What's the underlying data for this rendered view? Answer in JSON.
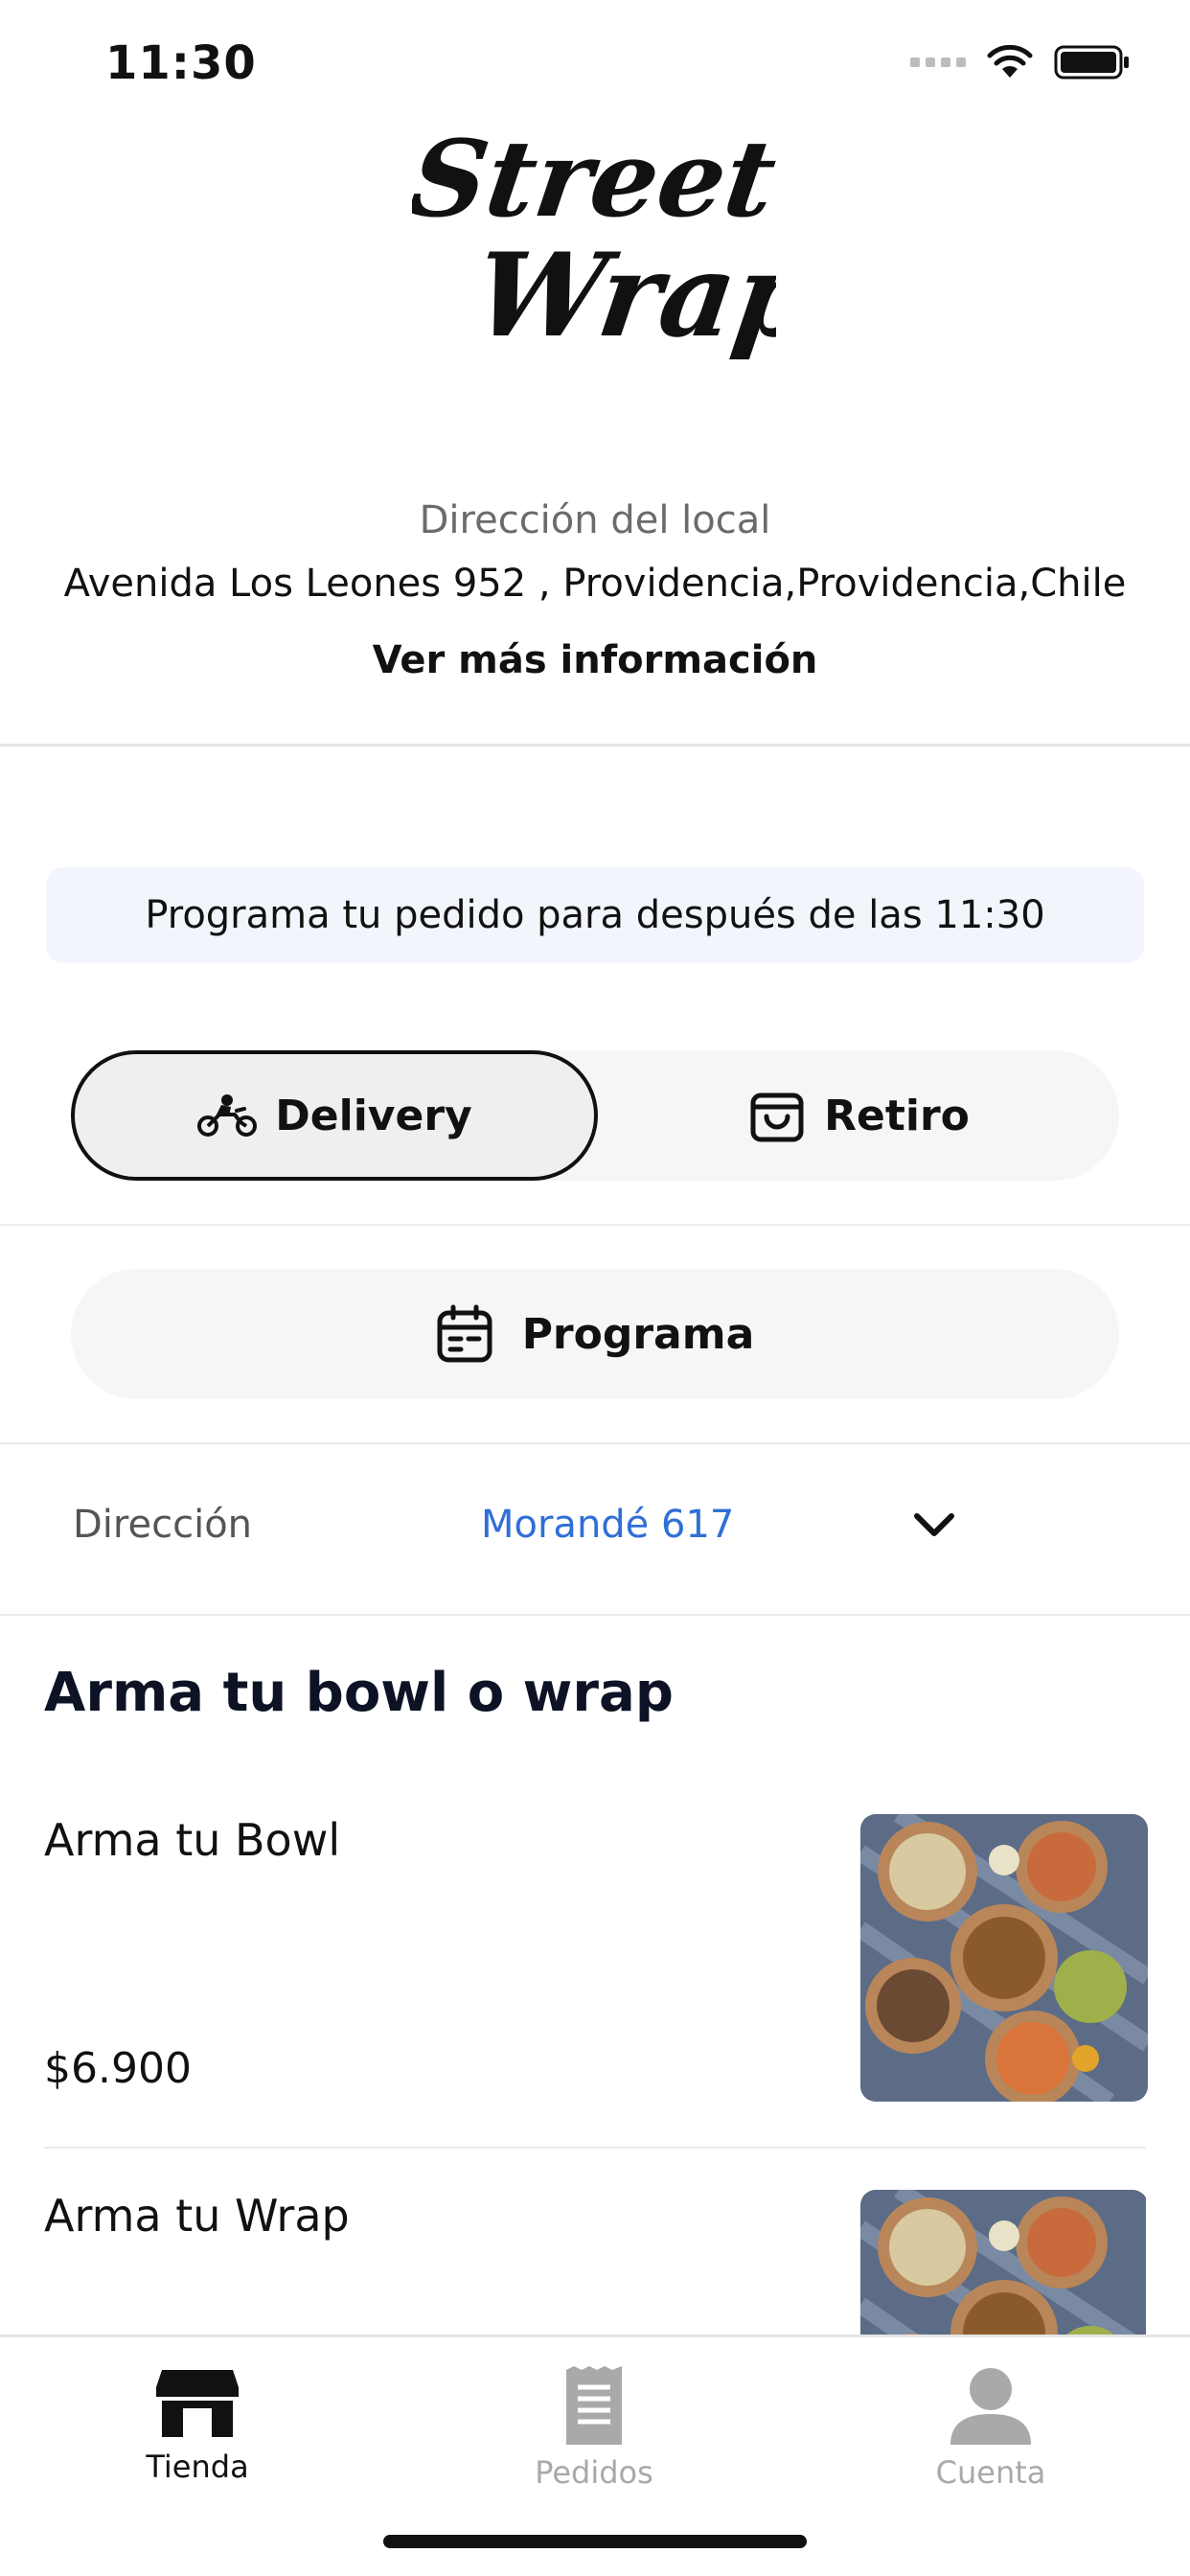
{
  "status_bar": {
    "time": "11:30"
  },
  "brand": {
    "logo_line1": "Street",
    "logo_line2": "Wrap"
  },
  "store": {
    "label": "Dirección del local",
    "address": "Avenida Los Leones 952 , Providencia,Providencia,Chile",
    "more_info": "Ver más información"
  },
  "schedule_banner": "Programa tu pedido para después de las 11:30",
  "order_mode": {
    "selected": "Delivery",
    "options": [
      {
        "label": "Delivery",
        "icon": "motorcycle-icon"
      },
      {
        "label": "Retiro",
        "icon": "shopping-bag-icon"
      }
    ]
  },
  "programa": {
    "label": "Programa",
    "icon": "calendar-icon"
  },
  "address_selector": {
    "label": "Dirección",
    "value": "Morandé 617",
    "icon": "chevron-down-icon"
  },
  "menu": {
    "section_title": "Arma tu bowl o wrap",
    "products": [
      {
        "name": "Arma tu Bowl",
        "price": "$6.900"
      },
      {
        "name": "Arma tu Wrap",
        "price": ""
      }
    ]
  },
  "tab_bar": {
    "tabs": [
      {
        "label": "Tienda",
        "icon": "store-icon",
        "active": true
      },
      {
        "label": "Pedidos",
        "icon": "receipt-icon",
        "active": false
      },
      {
        "label": "Cuenta",
        "icon": "user-icon",
        "active": false
      }
    ]
  },
  "colors": {
    "accent_blue": "#2f6fd6",
    "banner_bg": "#f2f6fc",
    "toggle_bg": "#f6f6f6",
    "inactive": "#a9a9a9"
  }
}
